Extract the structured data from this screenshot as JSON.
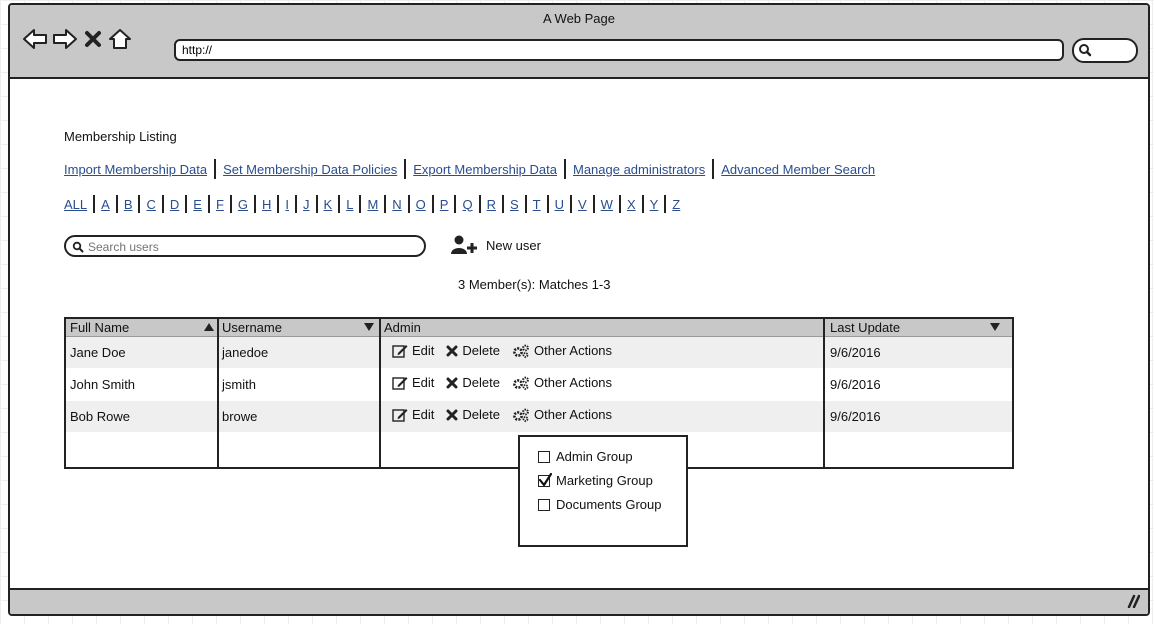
{
  "window": {
    "title": "A Web Page"
  },
  "browser": {
    "url": "http://",
    "icons": [
      "back-arrow-icon",
      "forward-arrow-icon",
      "close-icon",
      "home-icon",
      "search-icon"
    ]
  },
  "page": {
    "title": "Membership Listing",
    "links": [
      "Import Membership Data",
      "Set Membership Data Policies",
      "Export Membership Data",
      "Manage administrators",
      "Advanced Member Search"
    ],
    "alphabet": [
      "ALL",
      "A",
      "B",
      "C",
      "D",
      "E",
      "F",
      "G",
      "H",
      "I",
      "J",
      "K",
      "L",
      "M",
      "N",
      "O",
      "P",
      "Q",
      "R",
      "S",
      "T",
      "U",
      "V",
      "W",
      "X",
      "Y",
      "Z"
    ],
    "search": {
      "placeholder": "Search users",
      "value": ""
    },
    "new_user_label": "New user",
    "match_text": "3 Member(s): Matches 1-3"
  },
  "table": {
    "columns": [
      "Full Name",
      "Username",
      "Admin",
      "Last Update"
    ],
    "rows": [
      {
        "full_name": "Jane Doe",
        "username": "janedoe",
        "last_update": "9/6/2016"
      },
      {
        "full_name": "John Smith",
        "username": "jsmith",
        "last_update": "9/6/2016"
      },
      {
        "full_name": "Bob Rowe",
        "username": "browe",
        "last_update": "9/6/2016"
      }
    ],
    "actions": {
      "edit": "Edit",
      "delete": "Delete",
      "other": "Other Actions"
    }
  },
  "dropdown": {
    "items": [
      {
        "label": "Admin Group",
        "checked": false
      },
      {
        "label": "Marketing Group",
        "checked": true
      },
      {
        "label": "Documents Group",
        "checked": false
      }
    ]
  }
}
